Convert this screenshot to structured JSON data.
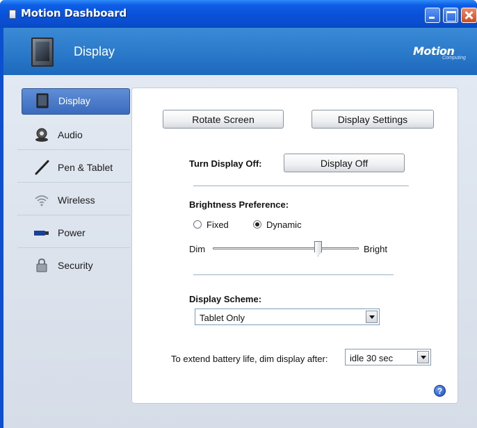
{
  "window": {
    "title": "Motion Dashboard"
  },
  "header": {
    "title": "Display",
    "brand": "Motion",
    "brand_sub": "Computing"
  },
  "sidebar": {
    "items": [
      {
        "label": "Display",
        "icon": "display-icon",
        "selected": true
      },
      {
        "label": "Audio",
        "icon": "speaker-icon",
        "selected": false
      },
      {
        "label": "Pen & Tablet",
        "icon": "pen-icon",
        "selected": false
      },
      {
        "label": "Wireless",
        "icon": "wireless-icon",
        "selected": false
      },
      {
        "label": "Power",
        "icon": "battery-icon",
        "selected": false
      },
      {
        "label": "Security",
        "icon": "lock-icon",
        "selected": false
      }
    ]
  },
  "main": {
    "rotate_label": "Rotate Screen",
    "settings_label": "Display Settings",
    "turn_off_label": "Turn Display Off:",
    "display_off_label": "Display Off",
    "brightness_heading": "Brightness Preference:",
    "fixed_label": "Fixed",
    "dynamic_label": "Dynamic",
    "selected_mode": "Dynamic",
    "dim_label": "Dim",
    "bright_label": "Bright",
    "brightness_level": 0.72,
    "scheme_heading": "Display Scheme:",
    "scheme_value": "Tablet Only",
    "battery_label": "To extend battery life, dim display after:",
    "idle_value": "idle 30 sec",
    "help_glyph": "?"
  }
}
